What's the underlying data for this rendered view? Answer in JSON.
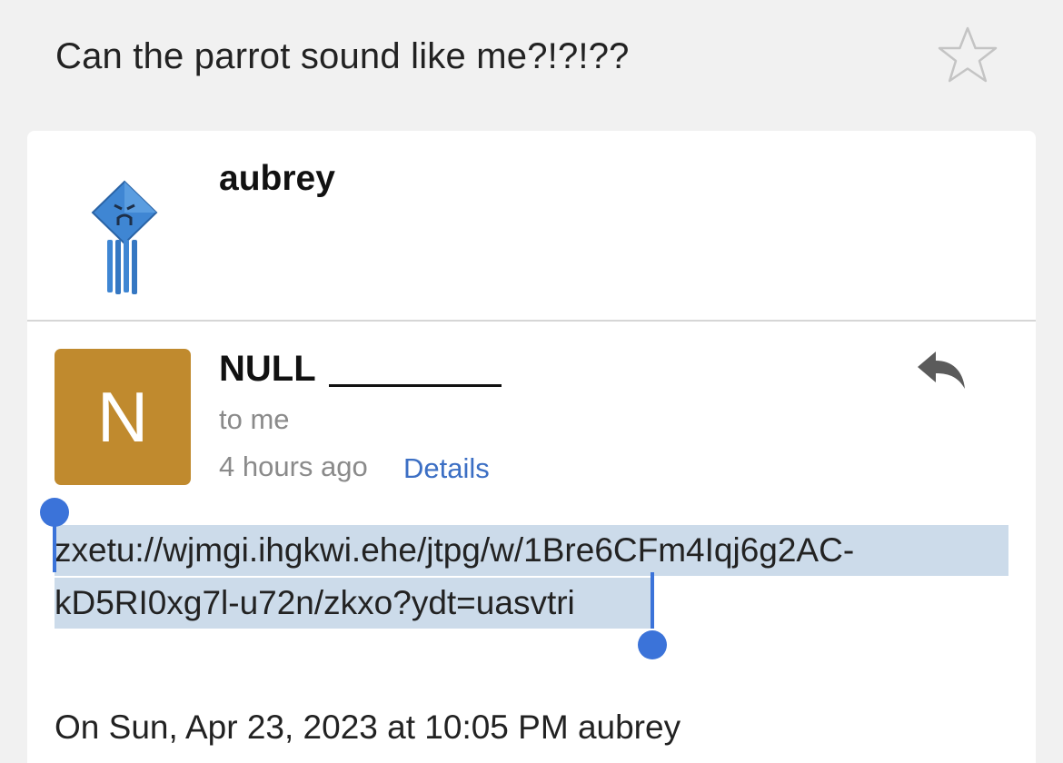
{
  "subject": "Can the parrot sound like me?!?!??",
  "thread": {
    "sender": "aubrey",
    "avatar_icon": "blue-diamond-squid-icon"
  },
  "message": {
    "avatar_letter": "N",
    "avatar_color": "#c08a2e",
    "sender": "NULL",
    "recipient": "to me",
    "time": "4 hours ago",
    "details_label": "Details",
    "link_line1": "zxetu://wjmgi.ihgkwi.ehe/jtpg/w/1Bre6CFm4Iqj6g2AC-",
    "link_line2": "kD5RI0xg7l-u72n/zkxo?ydt=uasvtri",
    "quote_header": "On Sun, Apr 23, 2023 at 10:05 PM aubrey"
  },
  "colors": {
    "selection": "#ccdbea",
    "selection_handle": "#3b73d9",
    "link_accent": "#3c6fc4"
  }
}
